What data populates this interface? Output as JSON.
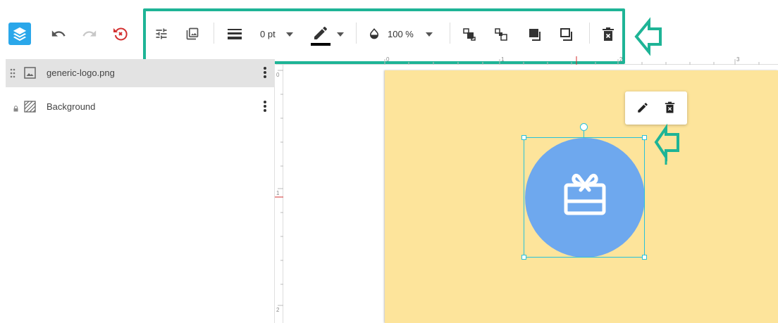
{
  "toolbar": {
    "layers_icon": "layers-icon",
    "undo_icon": "undo-icon",
    "redo_icon": "redo-icon",
    "reset_icon": "reset-icon",
    "adjust_icon": "sliders-icon",
    "image_icon": "image-replace-icon",
    "border_width_value": "0 pt",
    "border_color": "#000000",
    "opacity_value": "100 %",
    "highlight_color": "#1eb496",
    "accent_color": "#2aa7ea",
    "reset_color": "#d32f2f"
  },
  "layers": [
    {
      "name": "generic-logo.png",
      "icon": "image-icon",
      "selected": true
    },
    {
      "name": "Background",
      "icon": "background-pattern-icon",
      "locked": true
    }
  ],
  "rulers": {
    "top_labels": [
      "0",
      "1",
      "2",
      "3"
    ],
    "left_labels": [
      "0",
      "1",
      "2"
    ]
  },
  "canvas": {
    "page_color": "#fde49b",
    "logo_color": "#6ea8ee",
    "logo_icon": "gift-card-icon",
    "popup_actions": [
      "edit-icon",
      "delete-icon"
    ]
  }
}
